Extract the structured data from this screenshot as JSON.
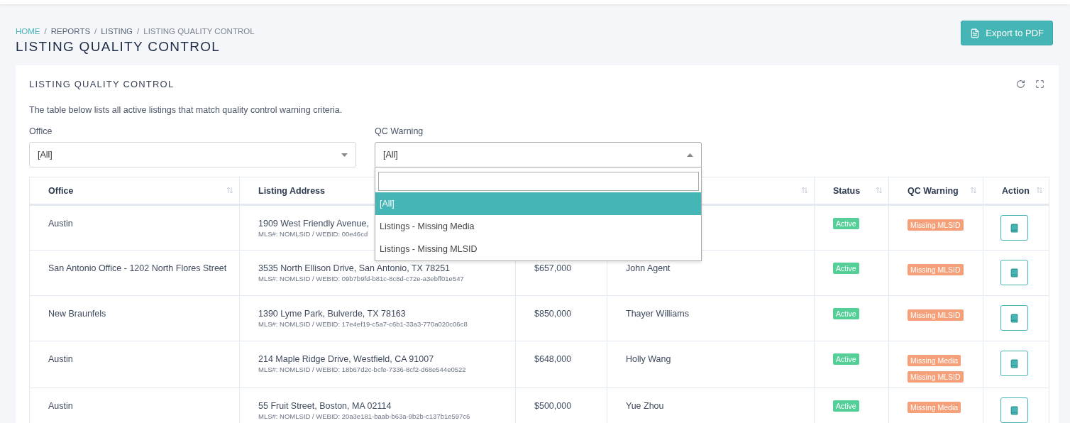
{
  "breadcrumb": [
    {
      "kind": "link",
      "label": "HOME"
    },
    {
      "kind": "separator",
      "label": "/"
    },
    {
      "kind": "item",
      "label": "REPORTS"
    },
    {
      "kind": "separator",
      "label": "/"
    },
    {
      "kind": "item",
      "label": "LISTING"
    },
    {
      "kind": "separator",
      "label": "/"
    },
    {
      "kind": "current",
      "label": "LISTING QUALITY CONTROL"
    }
  ],
  "page_title": "LISTING QUALITY CONTROL",
  "export_button": "Export to PDF",
  "card": {
    "title": "LISTING QUALITY CONTROL",
    "description": "The table below lists all active listings that match quality control warning criteria.",
    "filters": [
      {
        "label": "Office",
        "value": "[All]",
        "open": false
      },
      {
        "label": "QC Warning",
        "value": "[All]",
        "open": true,
        "options": [
          {
            "label": "[All]",
            "selected": true
          },
          {
            "label": "Listings - Missing Media",
            "selected": false
          },
          {
            "label": "Listings - Missing MLSID",
            "selected": false
          }
        ]
      }
    ]
  },
  "table": {
    "columns": [
      {
        "label": "Office",
        "sort_icon": true
      },
      {
        "label": "Listing Address"
      },
      {},
      {
        "sort_icon": true
      },
      {
        "label": "Status",
        "sort_icon": true
      },
      {
        "label": "QC Warning",
        "sort_icon": true
      },
      {
        "label": "Action",
        "sort_icon": true
      }
    ],
    "rows": [
      {
        "office": "Austin",
        "address": "1909 West Friendly Avenue,",
        "mls": "MLS#: NOMLSID / WEBID: 00e46cd",
        "status": "Active",
        "warnings": [
          "Missing MLSID"
        ]
      },
      {
        "office": "San Antonio Office - 1202 North Flores Street",
        "address": "3535 North Ellison Drive, San Antonio, TX 78251",
        "mls": "MLS#: NOMLSID / WEBID: 09b7b9fd-b81c-8c8d-c72e-a3ebff01e547",
        "price": "$657,000",
        "agent": "John Agent",
        "status": "Active",
        "warnings": [
          "Missing MLSID"
        ]
      },
      {
        "office": "New Braunfels",
        "address": "1390 Lyme Park, Bulverde, TX 78163",
        "mls": "MLS#: NOMLSID / WEBID: 17e4ef19-c5a7-c6b1-33a3-770a020c06c8",
        "price": "$850,000",
        "agent": "Thayer Williams",
        "status": "Active",
        "warnings": [
          "Missing MLSID"
        ]
      },
      {
        "office": "Austin",
        "address": "214 Maple Ridge Drive, Westfield, CA 91007",
        "mls": "MLS#: NOMLSID / WEBID: 18b67d2c-bcfe-7336-8cf2-d68e544e0522",
        "price": "$648,000",
        "agent": "Holly Wang",
        "status": "Active",
        "warnings": [
          "Missing Media",
          "Missing MLSID"
        ]
      },
      {
        "office": "Austin",
        "address": "55 Fruit Street, Boston, MA 02114",
        "mls": "MLS#: NOMLSID / WEBID: 20a3e181-baab-b63a-9b2b-c137b1e597c6",
        "price": "$500,000",
        "agent": "Yue Zhou",
        "status": "Active",
        "warnings": [
          "Missing Media"
        ]
      }
    ]
  }
}
